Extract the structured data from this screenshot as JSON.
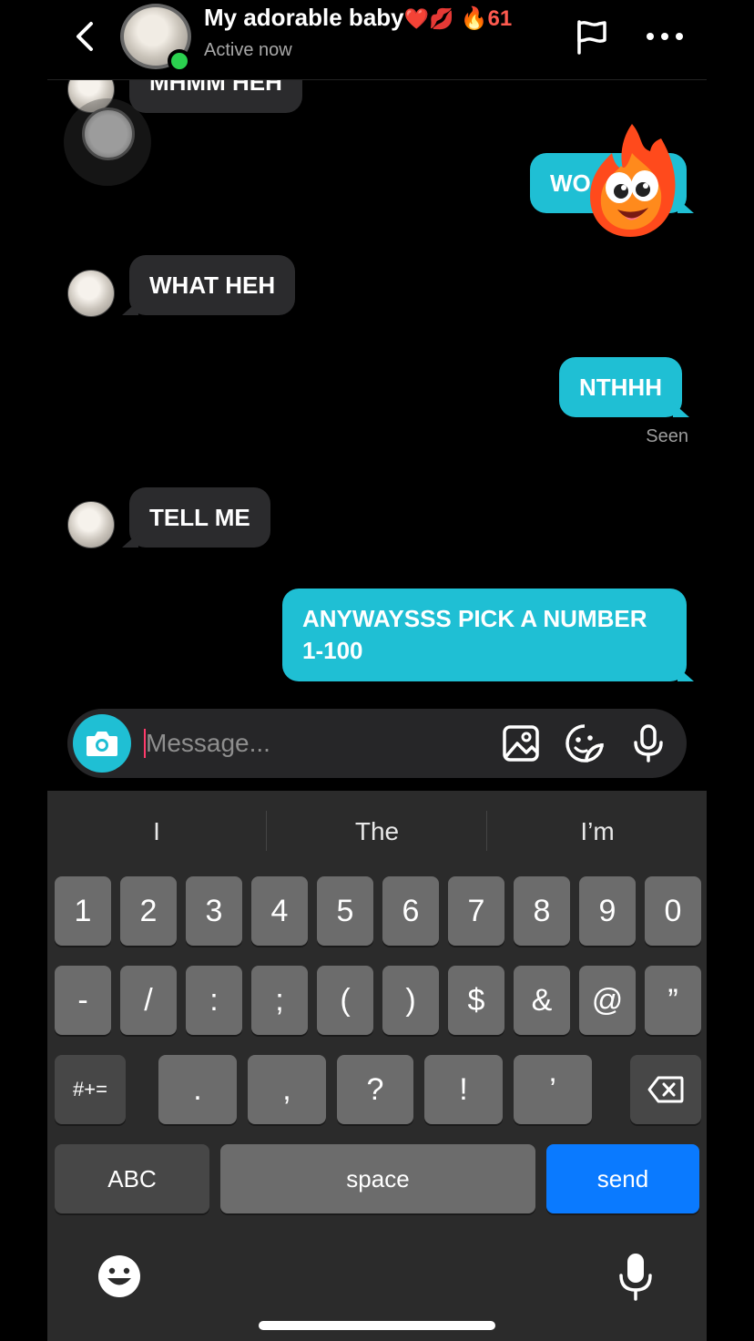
{
  "header": {
    "title": "My adorable baby",
    "title_emojis": "❤️💋",
    "streak_emoji": "🔥",
    "streak_count": "61",
    "status": "Active now"
  },
  "messages": {
    "clipped_in": "MHMM HEH",
    "out_wo": "WO",
    "in_what": "WHAT HEH",
    "out_nthhh": "NTHHH",
    "seen": "Seen",
    "in_tell": "TELL ME",
    "out_anyways": "ANYWAYSSS PICK A NUMBER 1-100"
  },
  "composer": {
    "placeholder": "Message..."
  },
  "keyboard": {
    "suggestions": [
      "I",
      "The",
      "I’m"
    ],
    "row1": [
      "1",
      "2",
      "3",
      "4",
      "5",
      "6",
      "7",
      "8",
      "9",
      "0"
    ],
    "row2": [
      "-",
      "/",
      ":",
      ";",
      "(",
      ")",
      "$",
      "&",
      "@",
      "”"
    ],
    "row3_shift": "#+=",
    "row3": [
      ".",
      ",",
      "?",
      "!",
      "’"
    ],
    "abc": "ABC",
    "space": "space",
    "send": "send"
  },
  "colors": {
    "accent": "#1fbfd4",
    "incoming_bubble": "#2b2b2d",
    "send_key": "#0a7aff",
    "active_dot": "#2bd14f"
  },
  "icons": {
    "back": "chevron-left-icon",
    "report": "flag-icon",
    "more": "more-horizontal-icon",
    "camera": "camera-icon",
    "gallery": "image-icon",
    "sticker": "sticker-icon",
    "voice": "microphone-icon",
    "delete": "backspace-icon",
    "emoji": "emoji-icon",
    "dictation": "microphone-icon"
  }
}
